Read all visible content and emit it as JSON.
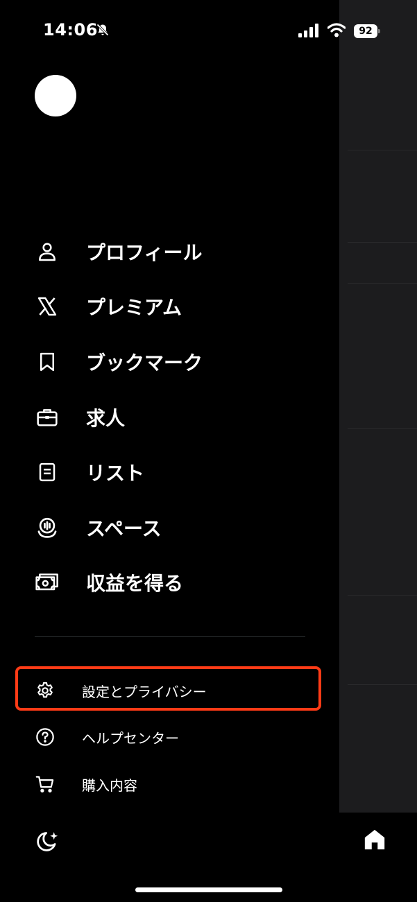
{
  "status_bar": {
    "time": "14:06",
    "battery": "92",
    "icons": [
      "bell-slash-icon",
      "signal-icon",
      "wifi-icon",
      "battery-icon"
    ]
  },
  "drawer": {
    "menu_items": [
      {
        "label": "プロフィール",
        "icon": "person-icon"
      },
      {
        "label": "プレミアム",
        "icon": "x-logo-icon"
      },
      {
        "label": "ブックマーク",
        "icon": "bookmark-icon"
      },
      {
        "label": "求人",
        "icon": "briefcase-icon"
      },
      {
        "label": "リスト",
        "icon": "list-icon"
      },
      {
        "label": "スペース",
        "icon": "spaces-icon"
      },
      {
        "label": "収益を得る",
        "icon": "money-icon"
      }
    ],
    "secondary_items": [
      {
        "label": "設定とプライバシー",
        "icon": "gear-icon"
      },
      {
        "label": "ヘルプセンター",
        "icon": "help-icon"
      },
      {
        "label": "購入内容",
        "icon": "cart-icon"
      }
    ],
    "footer_icon": "moon-icon"
  },
  "right_pane": {
    "tab_icon": "home-icon"
  },
  "colors": {
    "background": "#000000",
    "text": "#ffffff",
    "highlight": "#ff3b16",
    "right_pane": "#1c1c1e"
  }
}
